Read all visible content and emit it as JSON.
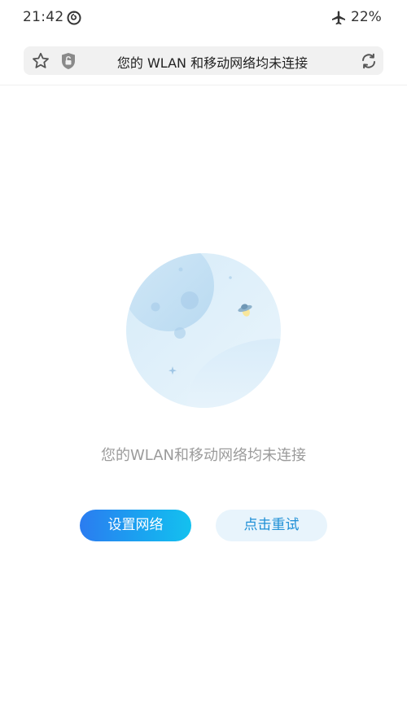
{
  "status_bar": {
    "time": "21:42",
    "battery": "22%",
    "icons": [
      "netease-music-icon",
      "airplane-mode-icon"
    ]
  },
  "address_bar": {
    "text": "您的 WLAN 和移动网络均未连接",
    "icons": [
      "star-icon",
      "shield-lock-icon",
      "refresh-icon"
    ]
  },
  "main": {
    "illustration": "moon-planet-icon",
    "message": "您的WLAN和移动网络均未连接",
    "settings_button": "设置网络",
    "retry_button": "点击重试"
  },
  "colors": {
    "primary_gradient_start": "#2b7cf0",
    "primary_gradient_end": "#14c1ef",
    "secondary_bg": "#e8f4fc",
    "secondary_text": "#1e8fd6",
    "message_text": "#9b9b9b"
  }
}
